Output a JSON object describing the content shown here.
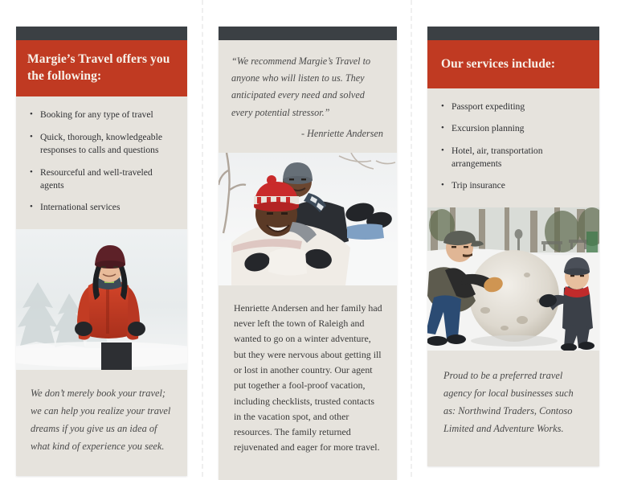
{
  "document": {
    "kind": "tri-fold travel brochure",
    "brand": "Margie's Travel"
  },
  "theme": {
    "accent_red": "#c03a22",
    "rule_dark": "#3b4044",
    "panel_bg": "#e6e3dd",
    "page_bg": "#ffffff",
    "body_text": "#3a3a3a",
    "fold_line": "#efefef"
  },
  "panels": {
    "left": {
      "banner_title": "Margie’s Travel offers you the following:",
      "bullet_marker": "•",
      "bullets": [
        "Booking for any type of travel",
        "Quick, thorough, knowledgeable responses to calls and questions",
        "Resourceful and well-traveled agents",
        "International services"
      ],
      "photo_alt": "Child in a red winter jacket standing in snow with snow-covered pine trees",
      "pull_quote": "We don’t merely book your travel; we can help you realize your travel dreams if you give us an idea of what kind of experience you seek."
    },
    "middle": {
      "quote": "“We recommend Margie’s Travel to anyone who will listen to us. They anticipated every need and solved every potential stressor.”",
      "attribution": "- Henriette Andersen",
      "photo_alt": "Smiling man in a white coat and red knit hat lying in the snow with a child in a grey hat on his back",
      "body": "Henriette Andersen and her family had never left the town of Raleigh and wanted to go on a winter adventure, but they were nervous about getting ill or lost in another country. Our agent put together a fool-proof vacation, including checklists, trusted contacts in the vacation spot, and other resources. The family returned rejuvenated and eager for more travel."
    },
    "right": {
      "banner_title": "Our services include:",
      "bullet_marker": "•",
      "bullets": [
        "Passport expediting",
        "Excursion planning",
        "Hotel, air, transportation arrangements",
        "Trip insurance"
      ],
      "photo_alt": "A man in a flat cap and a small child in a snowsuit rolling a giant snowball in a snowy park",
      "pull_quote": "Proud to be a preferred travel agency for local businesses such as: Northwind Traders, Contoso Limited and Adventure Works."
    }
  }
}
